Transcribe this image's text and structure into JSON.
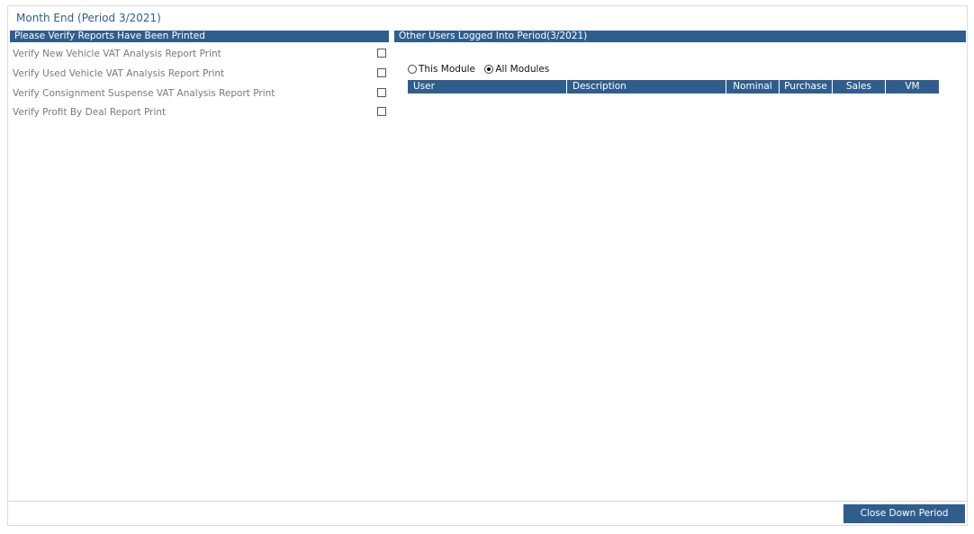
{
  "title": "Month End (Period 3/2021)",
  "left_panel": {
    "header": "Please Verify Reports Have Been Printed",
    "items": [
      {
        "label": "Verify New Vehicle VAT Analysis Report Print",
        "checked": false
      },
      {
        "label": "Verify Used Vehicle VAT Analysis Report Print",
        "checked": false
      },
      {
        "label": "Verify Consignment Suspense VAT Analysis Report Print",
        "checked": false
      },
      {
        "label": "Verify Profit By Deal Report Print",
        "checked": false
      }
    ]
  },
  "right_panel": {
    "header": "Other Users Logged Into Period(3/2021)",
    "radio_options": [
      {
        "label": "This Module",
        "selected": false
      },
      {
        "label": "All Modules",
        "selected": true
      }
    ],
    "columns": [
      "User",
      "Description",
      "Nominal",
      "Purchase",
      "Sales",
      "VM"
    ]
  },
  "footer": {
    "close_button": "Close Down Period"
  }
}
